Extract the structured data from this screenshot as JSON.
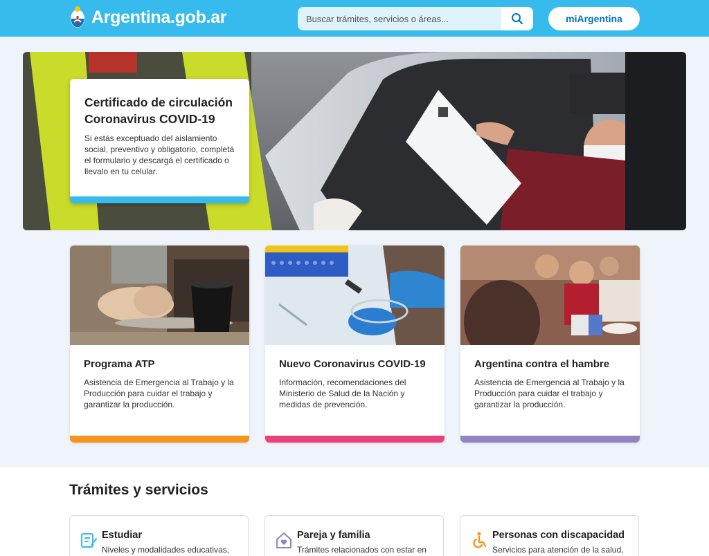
{
  "header": {
    "site_name": "Argentina.gob.ar",
    "search_placeholder": "Buscar trámites, servicios o áreas...",
    "account_button": "miArgentina"
  },
  "hero": {
    "title": "Certificado de circulación Coronavirus COVID-19",
    "text": "Si estás exceptuado del aislamiento social, preventivo y obligatorio, completá el formulario y descargá el certificado o llevalo en tu celular."
  },
  "features": [
    {
      "title": "Programa ATP",
      "text": "Asistencia de Emergencia al Trabajo y la Producción para cuidar el trabajo y garantizar la producción.",
      "accent": "#f7941d"
    },
    {
      "title": "Nuevo Coronavirus COVID-19",
      "text": "Información, recomendaciones del Ministerio de Salud de la Nación y medidas de prevención.",
      "accent": "#ec407a"
    },
    {
      "title": "Argentina contra el hambre",
      "text": "Asistencia de Emergencia al Trabajo y la Producción para cuidar el trabajo y garantizar la producción.",
      "accent": "#9283be"
    }
  ],
  "tramites": {
    "title": "Trámites y servicios",
    "items": [
      {
        "title": "Estudiar",
        "text": "Niveles y modalidades educativas,",
        "icon": "education-icon"
      },
      {
        "title": "Pareja y familia",
        "text": "Trámites relacionados con estar en",
        "icon": "family-home-icon"
      },
      {
        "title": "Personas con discapacidad",
        "text": "Servicios para atención de la salud,",
        "icon": "wheelchair-icon"
      }
    ]
  },
  "colors": {
    "brand": "#37bbed",
    "link": "#0072bb",
    "page_background": "#eef4fa"
  }
}
